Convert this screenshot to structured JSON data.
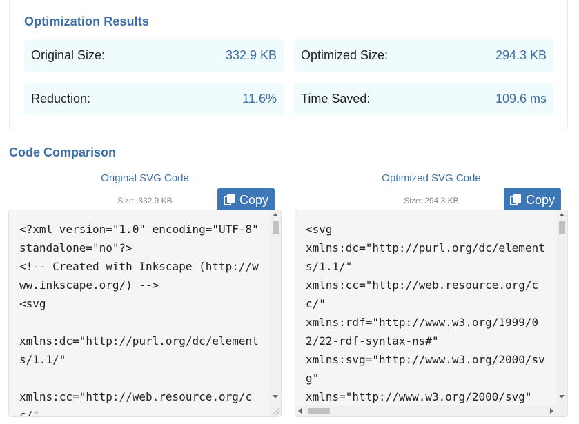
{
  "results": {
    "title": "Optimization Results",
    "original_size_label": "Original Size:",
    "original_size_value": "332.9 KB",
    "optimized_size_label": "Optimized Size:",
    "optimized_size_value": "294.3 KB",
    "reduction_label": "Reduction:",
    "reduction_value": "11.6%",
    "time_saved_label": "Time Saved:",
    "time_saved_value": "109.6 ms"
  },
  "comparison": {
    "title": "Code Comparison",
    "original": {
      "heading": "Original SVG Code",
      "size": "Size: 332.9 KB",
      "copy_label": "Copy",
      "code": "<?xml version=\"1.0\" encoding=\"UTF-8\" standalone=\"no\"?>\n<!-- Created with Inkscape (http://www.inkscape.org/) -->\n<svg\n\nxmlns:dc=\"http://purl.org/dc/elements/1.1/\"\n\nxmlns:cc=\"http://web.resource.org/cc/\""
    },
    "optimized": {
      "heading": "Optimized SVG Code",
      "size": "Size: 294.3 KB",
      "copy_label": "Copy",
      "code": "<svg\nxmlns:dc=\"http://purl.org/dc/elements/1.1/\"\nxmlns:cc=\"http://web.resource.org/cc/\"\nxmlns:rdf=\"http://www.w3.org/1999/02/22-rdf-syntax-ns#\"\nxmlns:svg=\"http://www.w3.org/2000/svg\"\nxmlns=\"http://www.w3.org/2000/svg\""
    }
  },
  "colors": {
    "accent": "#3d6fa6",
    "button": "#3d77b5",
    "stat_background": "#f0fbfd",
    "code_background": "#f5f5f5"
  },
  "icons": {
    "copy": "copy-icon"
  }
}
